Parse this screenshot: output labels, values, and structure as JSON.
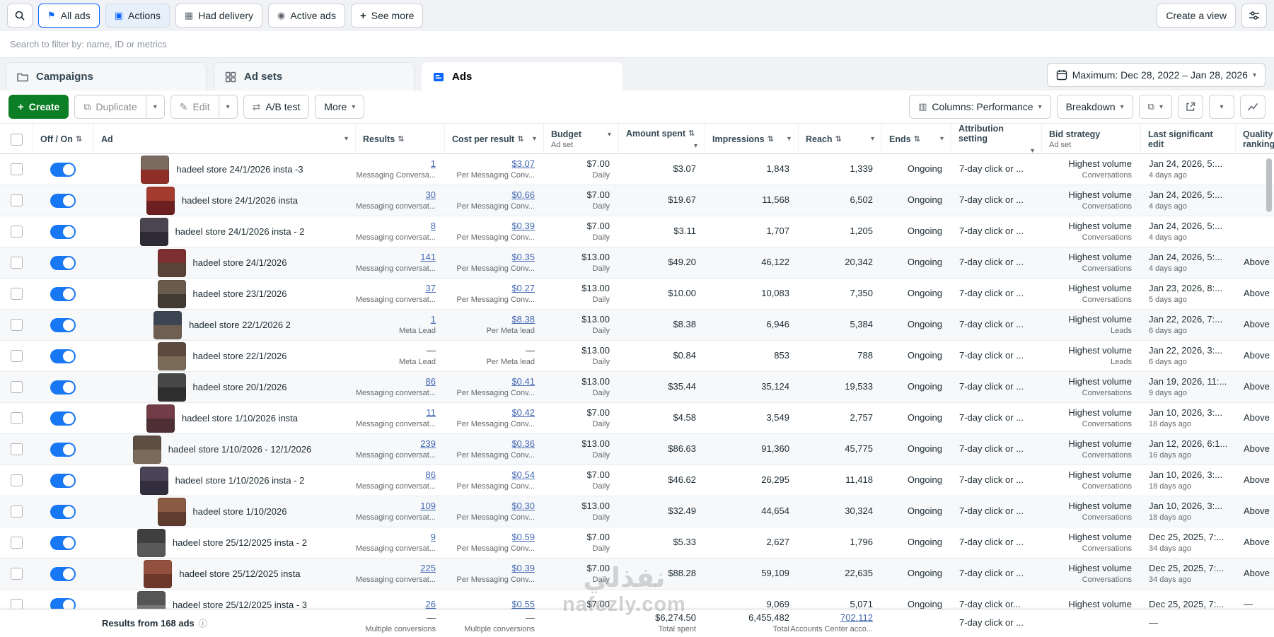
{
  "colors": {
    "accent_blue": "#0866ff",
    "toggle_on": "#1877f2",
    "link_blue": "#4267b2",
    "create_green": "#0c7e26",
    "page_bg": "#f0f2f5"
  },
  "glyphs": {
    "plus": "+",
    "caret": "▾",
    "sort": "⇅",
    "info": "ⓘ",
    "flag": "⚑",
    "actions": "▣",
    "delivery": "▦",
    "active": "◉",
    "pencil": "✎",
    "duplicate": "⧉",
    "abtest": "⇄",
    "columns_icon": "▥",
    "layers": "⧉"
  },
  "filter_bar": {
    "pills": [
      {
        "label": "All ads"
      },
      {
        "label": "Actions"
      },
      {
        "label": "Had delivery"
      },
      {
        "label": "Active ads"
      }
    ],
    "see_more": "See more",
    "create_view": "Create a view"
  },
  "search": {
    "placeholder": "Search to filter by: name, ID or metrics"
  },
  "tabs": [
    {
      "label": "Campaigns"
    },
    {
      "label": "Ad sets"
    },
    {
      "label": "Ads",
      "active": true
    }
  ],
  "date_range": "Maximum: Dec 28, 2022 – Jan 28, 2026",
  "toolbar": {
    "create": "Create",
    "duplicate": "Duplicate",
    "edit": "Edit",
    "ab_test": "A/B test",
    "more": "More",
    "columns": "Columns: Performance",
    "breakdown": "Breakdown"
  },
  "watermark": {
    "line1": "نفذلي",
    "line2": "nafezly.com"
  },
  "table": {
    "columns": [
      {
        "id": "select",
        "label": ""
      },
      {
        "id": "onoff",
        "label": "Off / On",
        "sort": true
      },
      {
        "id": "ad",
        "label": "Ad",
        "menu": true
      },
      {
        "id": "results",
        "label": "Results",
        "sort": true
      },
      {
        "id": "cost-per-result",
        "label": "Cost per result",
        "sort": true,
        "menu": true
      },
      {
        "id": "budget",
        "label": "Budget",
        "sub": "Ad set",
        "menu": true
      },
      {
        "id": "amount-spent",
        "label": "Amount spent",
        "sort": true,
        "menu": true
      },
      {
        "id": "impressions",
        "label": "Impressions",
        "sort": true,
        "menu": true
      },
      {
        "id": "reach",
        "label": "Reach",
        "sort": true,
        "menu": true
      },
      {
        "id": "ends",
        "label": "Ends",
        "sort": true,
        "menu": true
      },
      {
        "id": "attribution-setting",
        "label": "Attribution setting",
        "menu": true
      },
      {
        "id": "bid-strategy",
        "label": "Bid strategy",
        "sub": "Ad set"
      },
      {
        "id": "last-significant-edit",
        "label": "Last significant edit"
      },
      {
        "id": "quality-ranking",
        "label": "Quality ranking"
      }
    ],
    "rows": [
      {
        "name": "hadeel store 24/1/2026 insta -3",
        "thumb": [
          "#7a6a5f",
          "#8f2f2a"
        ],
        "results": "1",
        "results_sub": "Messaging Conversa...",
        "cost": "$3.07",
        "cost_sub": "Per Messaging Conv...",
        "budget": "$7.00",
        "budget_sub": "Daily",
        "spent": "$3.07",
        "impressions": "1,843",
        "reach": "1,339",
        "ends": "Ongoing",
        "attribution": "7-day click or ...",
        "bid": "Highest volume",
        "bid_sub": "Conversations",
        "edit": "Jan 24, 2026, 5:...",
        "edit_ago": "4 days ago",
        "quality": ""
      },
      {
        "name": "hadeel store 24/1/2026 insta",
        "thumb": [
          "#a33b2e",
          "#6b1f1f"
        ],
        "results": "30",
        "results_sub": "Messaging conversat...",
        "cost": "$0.66",
        "cost_sub": "Per Messaging Conv...",
        "budget": "$7.00",
        "budget_sub": "Daily",
        "spent": "$19.67",
        "impressions": "11,568",
        "reach": "6,502",
        "ends": "Ongoing",
        "attribution": "7-day click or ...",
        "bid": "Highest volume",
        "bid_sub": "Conversations",
        "edit": "Jan 24, 2026, 5:...",
        "edit_ago": "4 days ago",
        "quality": ""
      },
      {
        "name": "hadeel store 24/1/2026 insta - 2",
        "thumb": [
          "#4a4550",
          "#2f2b36"
        ],
        "results": "8",
        "results_sub": "Messaging conversat...",
        "cost": "$0.39",
        "cost_sub": "Per Messaging Conv...",
        "budget": "$7.00",
        "budget_sub": "Daily",
        "spent": "$3.11",
        "impressions": "1,707",
        "reach": "1,205",
        "ends": "Ongoing",
        "attribution": "7-day click or ...",
        "bid": "Highest volume",
        "bid_sub": "Conversations",
        "edit": "Jan 24, 2026, 5:...",
        "edit_ago": "4 days ago",
        "quality": ""
      },
      {
        "name": "hadeel store 24/1/2026",
        "thumb": [
          "#7d2f2f",
          "#5a4338"
        ],
        "results": "141",
        "results_sub": "Messaging conversat...",
        "cost": "$0.35",
        "cost_sub": "Per Messaging Conv...",
        "budget": "$13.00",
        "budget_sub": "Daily",
        "spent": "$49.20",
        "impressions": "46,122",
        "reach": "20,342",
        "ends": "Ongoing",
        "attribution": "7-day click or ...",
        "bid": "Highest volume",
        "bid_sub": "Conversations",
        "edit": "Jan 24, 2026, 5:...",
        "edit_ago": "4 days ago",
        "quality": "Above"
      },
      {
        "name": "hadeel store 23/1/2026",
        "thumb": [
          "#6b5b4c",
          "#403a33"
        ],
        "results": "37",
        "results_sub": "Messaging conversat...",
        "cost": "$0.27",
        "cost_sub": "Per Messaging Conv...",
        "budget": "$13.00",
        "budget_sub": "Daily",
        "spent": "$10.00",
        "impressions": "10,083",
        "reach": "7,350",
        "ends": "Ongoing",
        "attribution": "7-day click or ...",
        "bid": "Highest volume",
        "bid_sub": "Conversations",
        "edit": "Jan 23, 2026, 8:...",
        "edit_ago": "5 days ago",
        "quality": "Above"
      },
      {
        "name": "hadeel store 22/1/2026 2",
        "thumb": [
          "#3c4652",
          "#6e5f52"
        ],
        "results": "1",
        "results_sub": "Meta Lead",
        "cost": "$8.38",
        "cost_sub": "Per Meta lead",
        "budget": "$13.00",
        "budget_sub": "Daily",
        "spent": "$8.38",
        "impressions": "6,946",
        "reach": "5,384",
        "ends": "Ongoing",
        "attribution": "7-day click or ...",
        "bid": "Highest volume",
        "bid_sub": "Leads",
        "edit": "Jan 22, 2026, 7:...",
        "edit_ago": "6 days ago",
        "quality": "Above"
      },
      {
        "name": "hadeel store 22/1/2026",
        "thumb": [
          "#5d4a3e",
          "#7a6a58"
        ],
        "results": "—",
        "results_sub": "Meta Lead",
        "cost": "—",
        "cost_sub": "Per Meta lead",
        "budget": "$13.00",
        "budget_sub": "Daily",
        "spent": "$0.84",
        "impressions": "853",
        "reach": "788",
        "ends": "Ongoing",
        "attribution": "7-day click or ...",
        "bid": "Highest volume",
        "bid_sub": "Leads",
        "edit": "Jan 22, 2026, 3:...",
        "edit_ago": "6 days ago",
        "quality": "Above"
      },
      {
        "name": "hadeel store 20/1/2026",
        "thumb": [
          "#474747",
          "#2e2e2e"
        ],
        "results": "86",
        "results_sub": "Messaging conversat...",
        "cost": "$0.41",
        "cost_sub": "Per Messaging Conv...",
        "budget": "$13.00",
        "budget_sub": "Daily",
        "spent": "$35.44",
        "impressions": "35,124",
        "reach": "19,533",
        "ends": "Ongoing",
        "attribution": "7-day click or ...",
        "bid": "Highest volume",
        "bid_sub": "Conversations",
        "edit": "Jan 19, 2026, 11:...",
        "edit_ago": "9 days ago",
        "quality": "Above"
      },
      {
        "name": "hadeel store 1/10/2026 insta",
        "thumb": [
          "#733d47",
          "#4e2f36"
        ],
        "results": "11",
        "results_sub": "Messaging conversat...",
        "cost": "$0.42",
        "cost_sub": "Per Messaging Conv...",
        "budget": "$7.00",
        "budget_sub": "Daily",
        "spent": "$4.58",
        "impressions": "3,549",
        "reach": "2,757",
        "ends": "Ongoing",
        "attribution": "7-day click or ...",
        "bid": "Highest volume",
        "bid_sub": "Conversations",
        "edit": "Jan 10, 2026, 3:...",
        "edit_ago": "18 days ago",
        "quality": "Above"
      },
      {
        "name": "hadeel store 1/10/2026 - 12/1/2026",
        "thumb": [
          "#5c4e42",
          "#7b6b5c"
        ],
        "results": "239",
        "results_sub": "Messaging conversat...",
        "cost": "$0.36",
        "cost_sub": "Per Messaging Conv...",
        "budget": "$13.00",
        "budget_sub": "Daily",
        "spent": "$86.63",
        "impressions": "91,360",
        "reach": "45,775",
        "ends": "Ongoing",
        "attribution": "7-day click or ...",
        "bid": "Highest volume",
        "bid_sub": "Conversations",
        "edit": "Jan 12, 2026, 6:1...",
        "edit_ago": "16 days ago",
        "quality": "Above"
      },
      {
        "name": "hadeel store 1/10/2026 insta - 2",
        "thumb": [
          "#4a4256",
          "#332e3e"
        ],
        "results": "86",
        "results_sub": "Messaging conversat...",
        "cost": "$0.54",
        "cost_sub": "Per Messaging Conv...",
        "budget": "$7.00",
        "budget_sub": "Daily",
        "spent": "$46.62",
        "impressions": "26,295",
        "reach": "11,418",
        "ends": "Ongoing",
        "attribution": "7-day click or ...",
        "bid": "Highest volume",
        "bid_sub": "Conversations",
        "edit": "Jan 10, 2026, 3:...",
        "edit_ago": "18 days ago",
        "quality": "Above"
      },
      {
        "name": "hadeel store 1/10/2026",
        "thumb": [
          "#8a5a42",
          "#5f3c2e"
        ],
        "results": "109",
        "results_sub": "Messaging conversat...",
        "cost": "$0.30",
        "cost_sub": "Per Messaging Conv...",
        "budget": "$13.00",
        "budget_sub": "Daily",
        "spent": "$32.49",
        "impressions": "44,654",
        "reach": "30,324",
        "ends": "Ongoing",
        "attribution": "7-day click or ...",
        "bid": "Highest volume",
        "bid_sub": "Conversations",
        "edit": "Jan 10, 2026, 3:...",
        "edit_ago": "18 days ago",
        "quality": "Above"
      },
      {
        "name": "hadeel store 25/12/2025 insta - 2",
        "thumb": [
          "#3f3f3f",
          "#595959"
        ],
        "results": "9",
        "results_sub": "Messaging conversat...",
        "cost": "$0.59",
        "cost_sub": "Per Messaging Conv...",
        "budget": "$7.00",
        "budget_sub": "Daily",
        "spent": "$5.33",
        "impressions": "2,627",
        "reach": "1,796",
        "ends": "Ongoing",
        "attribution": "7-day click or ...",
        "bid": "Highest volume",
        "bid_sub": "Conversations",
        "edit": "Dec 25, 2025, 7:...",
        "edit_ago": "34 days ago",
        "quality": "Above"
      },
      {
        "name": "hadeel store 25/12/2025 insta",
        "thumb": [
          "#94503f",
          "#6e372b"
        ],
        "results": "225",
        "results_sub": "Messaging conversat...",
        "cost": "$0.39",
        "cost_sub": "Per Messaging Conv...",
        "budget": "$7.00",
        "budget_sub": "Daily",
        "spent": "$88.28",
        "impressions": "59,109",
        "reach": "22,635",
        "ends": "Ongoing",
        "attribution": "7-day click or ...",
        "bid": "Highest volume",
        "bid_sub": "Conversations",
        "edit": "Dec 25, 2025, 7:...",
        "edit_ago": "34 days ago",
        "quality": "Above"
      },
      {
        "name": "hadeel store 25/12/2025 insta - 3",
        "thumb": [
          "#555555",
          "#777777"
        ],
        "results": "26",
        "results_sub": "",
        "cost": "$0.55",
        "cost_sub": "",
        "budget": "$7.00",
        "budget_sub": "",
        "spent": "",
        "impressions": "9,069",
        "reach": "5,071",
        "ends": "Ongoing",
        "attribution": "7-day click or...",
        "bid": "Highest volume",
        "bid_sub": "",
        "edit": "Dec 25, 2025, 7:...",
        "edit_ago": "",
        "quality": "—"
      }
    ],
    "footer": {
      "label": "Results from 168 ads",
      "results": "—",
      "results_sub": "Multiple conversions",
      "cost": "—",
      "cost_sub": "Multiple conversions",
      "spent": "$6,274.50",
      "spent_sub": "Total spent",
      "impressions": "6,455,482",
      "impressions_sub": "Total",
      "reach": "702,112",
      "reach_sub": "Accounts Center acco...",
      "attribution": "7-day click or ...",
      "edit": "—"
    }
  }
}
